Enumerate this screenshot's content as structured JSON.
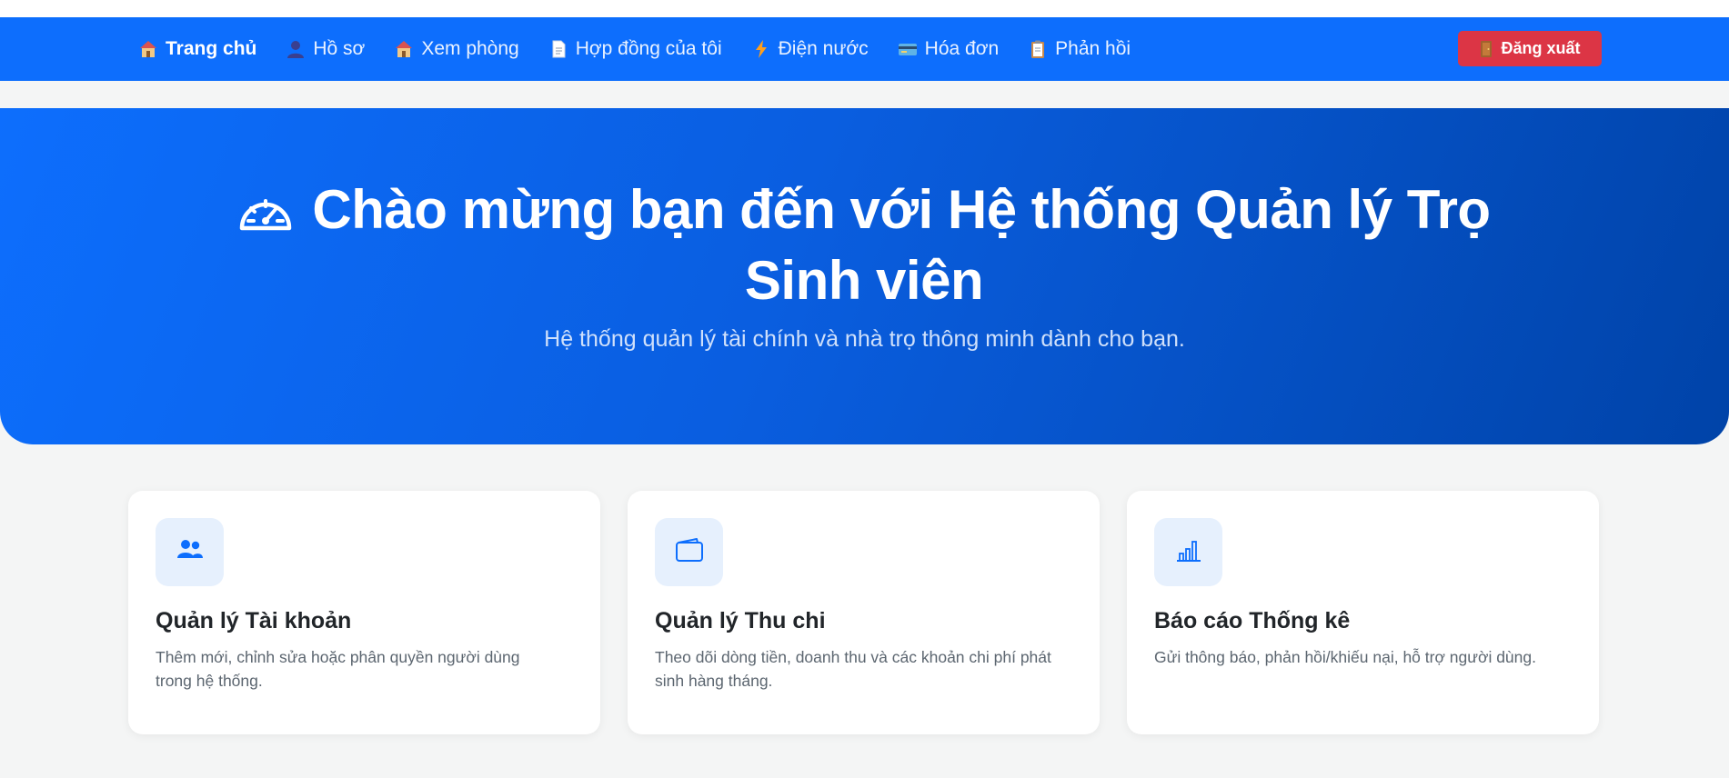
{
  "navbar": {
    "items": [
      {
        "label": "Trang chủ",
        "icon": "house-icon",
        "active": true
      },
      {
        "label": "Hồ sơ",
        "icon": "user-icon",
        "active": false
      },
      {
        "label": "Xem phòng",
        "icon": "house-icon",
        "active": false
      },
      {
        "label": "Hợp đồng của tôi",
        "icon": "document-icon",
        "active": false
      },
      {
        "label": "Điện nước",
        "icon": "lightning-icon",
        "active": false
      },
      {
        "label": "Hóa đơn",
        "icon": "credit-card-icon",
        "active": false
      },
      {
        "label": "Phản hồi",
        "icon": "clipboard-icon",
        "active": false
      }
    ],
    "logout_label": "Đăng xuất",
    "logout_icon": "door-icon"
  },
  "hero": {
    "icon": "speedometer-icon",
    "title": "Chào mừng bạn đến với Hệ thống Quản lý Trọ Sinh viên",
    "subtitle": "Hệ thống quản lý tài chính và nhà trọ thông minh dành cho bạn."
  },
  "cards": [
    {
      "icon": "people-icon",
      "title": "Quản lý Tài khoản",
      "description": "Thêm mới, chỉnh sửa hoặc phân quyền người dùng trong hệ thống."
    },
    {
      "icon": "wallet-icon",
      "title": "Quản lý Thu chi",
      "description": "Theo dõi dòng tiền, doanh thu và các khoản chi phí phát sinh hàng tháng."
    },
    {
      "icon": "bar-chart-icon",
      "title": "Báo cáo Thống kê",
      "description": "Gửi thông báo, phản hồi/khiếu nại, hỗ trợ người dùng."
    }
  ],
  "colors": {
    "primary": "#0d6efd",
    "danger": "#dc3545",
    "background": "#f4f5f5"
  }
}
